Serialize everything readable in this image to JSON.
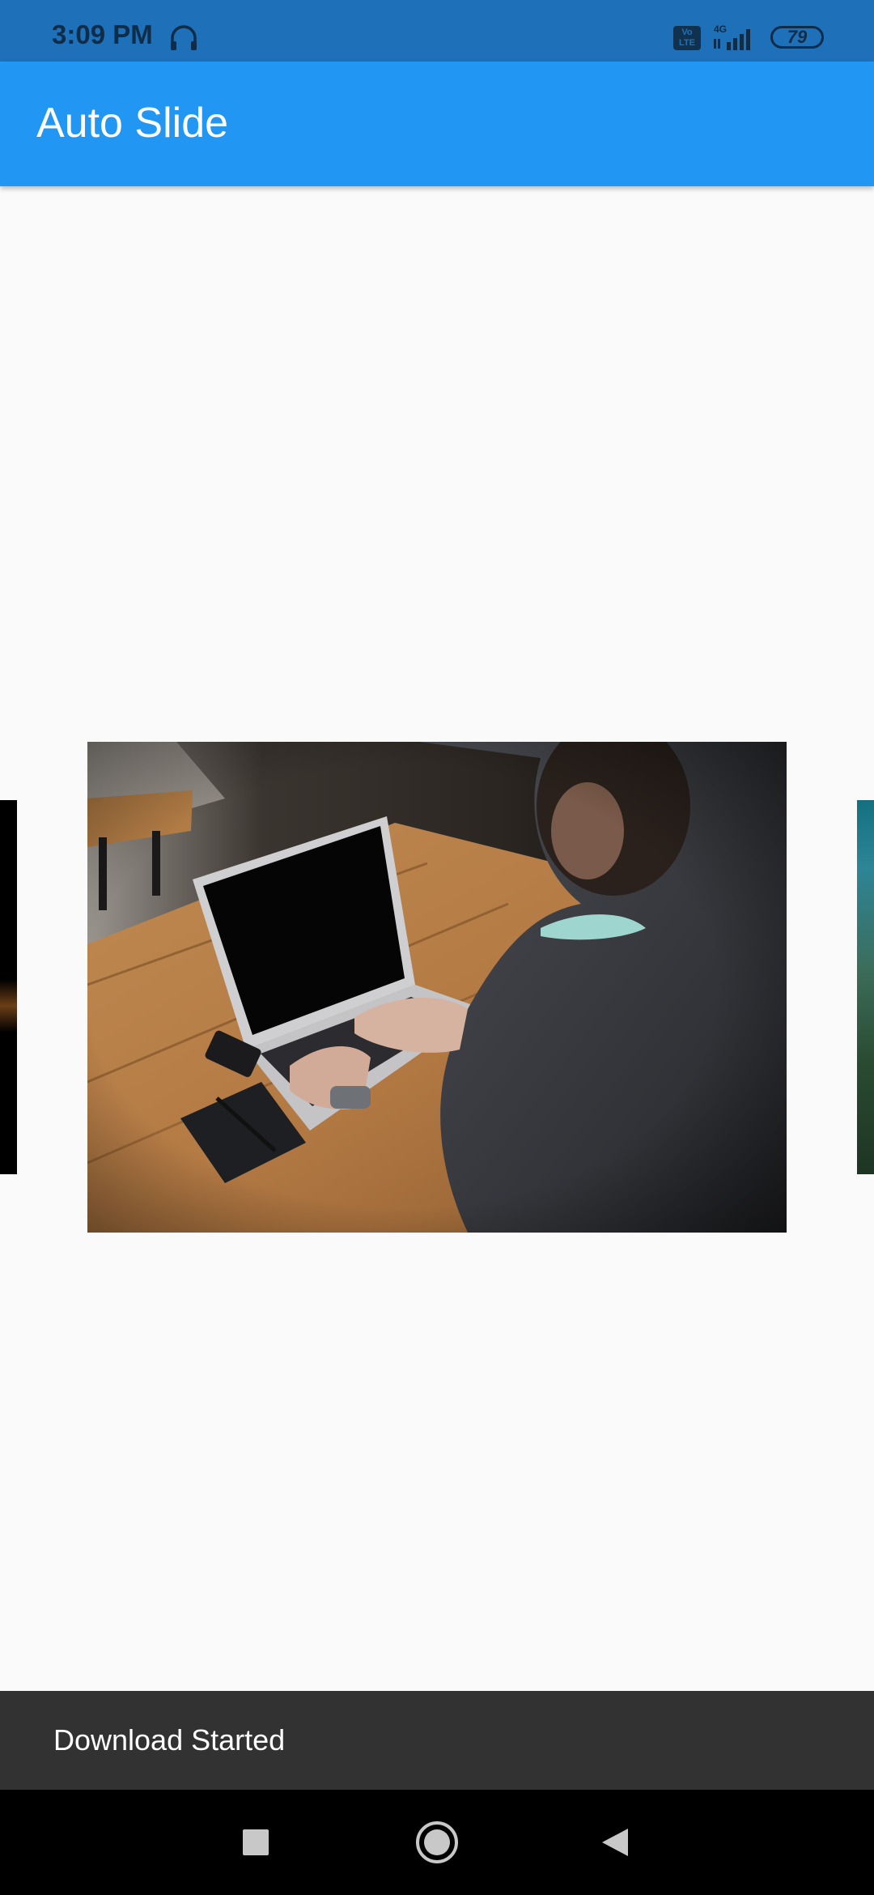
{
  "status_bar": {
    "time": "3:09 PM",
    "volte_label": "Vo LTE",
    "network": "4G",
    "battery": "79"
  },
  "app_bar": {
    "title": "Auto Slide"
  },
  "carousel": {
    "slides": [
      {
        "name": "previous-slide-image"
      },
      {
        "name": "laptop-desk-image"
      },
      {
        "name": "next-slide-image"
      }
    ]
  },
  "snackbar": {
    "message": "Download Started"
  },
  "nav_bar": {
    "icons": [
      "recents-square-icon",
      "home-circle-icon",
      "back-triangle-icon"
    ]
  },
  "colors": {
    "status_bar": "#1e71b8",
    "app_bar": "#2196f3",
    "background": "#fafafa",
    "snackbar": "#323232",
    "nav_bar": "#000000"
  }
}
